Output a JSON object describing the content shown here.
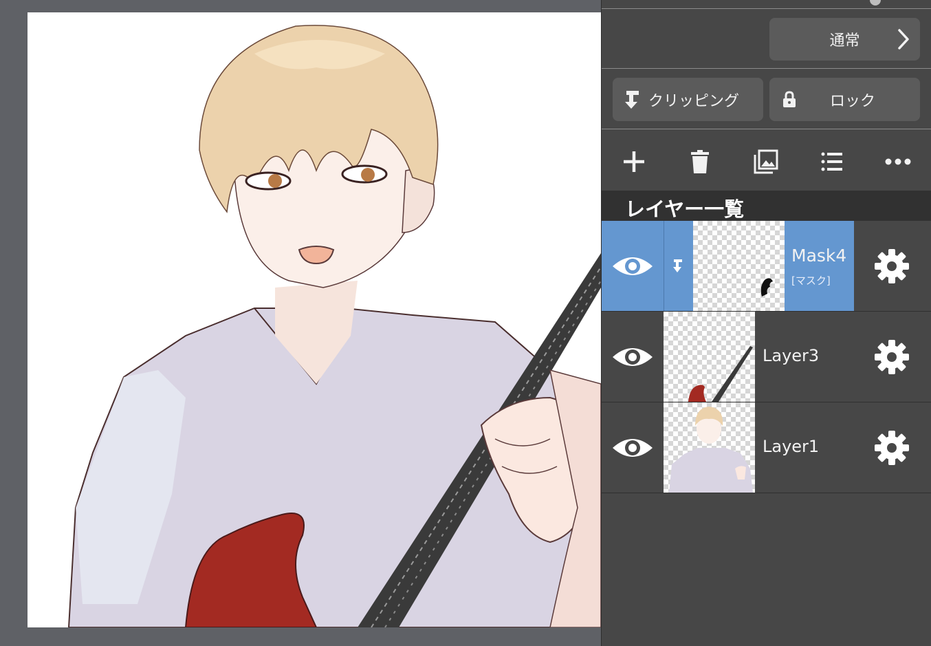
{
  "blend_mode": {
    "label": "通常"
  },
  "buttons": {
    "clipping": "クリッピング",
    "lock": "ロック"
  },
  "toolbar": {
    "icons": [
      "plus-icon",
      "trash-icon",
      "image-icon",
      "list-icon",
      "more-icon"
    ]
  },
  "layer_list": {
    "title": "レイヤー一覧",
    "layers": [
      {
        "name": "Mask4",
        "subtitle": "[マスク]",
        "selected": true,
        "clipped": true
      },
      {
        "name": "Layer3",
        "selected": false
      },
      {
        "name": "Layer1",
        "selected": false
      }
    ]
  },
  "colors": {
    "selected": "#6497d0",
    "panel": "#474747",
    "guitar_body": "#a32a22"
  }
}
